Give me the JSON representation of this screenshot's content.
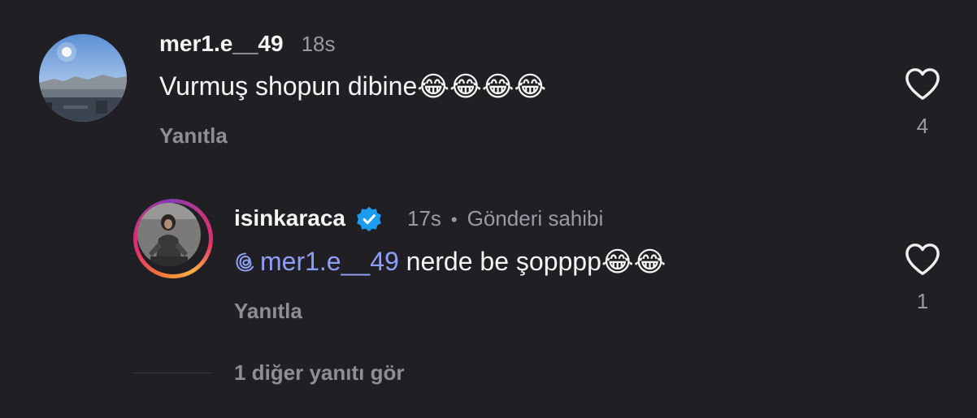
{
  "comments": [
    {
      "username": "mer1.e__49",
      "time": "18s",
      "text": "Vurmuş shopun dibine",
      "emoji": "😂😂😂😂",
      "reply_label": "Yanıtla",
      "like_count": "4",
      "icons": {
        "like": "heart-outline-icon",
        "avatar": "user-avatar-landscape"
      }
    },
    {
      "username": "isinkaraca",
      "time": "17s",
      "separator": "•",
      "owner_label": "Gönderi sahibi",
      "mention": "mer1.e__49",
      "text": " nerde be şopppp",
      "emoji": "😂😂",
      "reply_label": "Yanıtla",
      "like_count": "1",
      "icons": {
        "verified": "verified-badge-icon",
        "mention": "threads-icon",
        "like": "heart-outline-icon"
      }
    }
  ],
  "more_replies_label": "1 diğer yanıtı gör",
  "colors": {
    "background": "#1f1f24",
    "mention": "#8f9ef6",
    "verified": "#1d9bf0",
    "muted": "#9a9aa2"
  }
}
